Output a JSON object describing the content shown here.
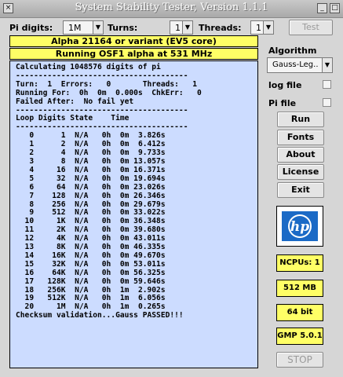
{
  "window": {
    "title": "System Stability Tester, Version 1.1.1"
  },
  "toolbar": {
    "pi_digits_label": "Pi digits:",
    "pi_digits_value": "1M",
    "turns_label": "Turns:",
    "turns_value": "1",
    "threads_label": "Threads:",
    "threads_value": "1",
    "test_label": "Test"
  },
  "banners": {
    "cpu": "Alpha 21164 or variant (EV5 core)",
    "os": "Running OSF1 alpha at 531 MHz"
  },
  "console": {
    "lines": [
      "Calculating 1048576 digits of pi",
      "--------------------------------------",
      "Turn:  1  Errors:   0       Threads:   1",
      "Running For:  0h  0m  0.000s  ChkErr:   0",
      "Failed After:  No fail yet",
      "--------------------------------------",
      "Loop Digits State    Time",
      "--------------------------------------",
      "   0      1  N/A   0h  0m  3.826s",
      "   1      2  N/A   0h  0m  6.412s",
      "   2      4  N/A   0h  0m  9.733s",
      "   3      8  N/A   0h  0m 13.057s",
      "   4     16  N/A   0h  0m 16.371s",
      "   5     32  N/A   0h  0m 19.694s",
      "   6     64  N/A   0h  0m 23.026s",
      "   7    128  N/A   0h  0m 26.346s",
      "   8    256  N/A   0h  0m 29.679s",
      "   9    512  N/A   0h  0m 33.022s",
      "  10     1K  N/A   0h  0m 36.348s",
      "  11     2K  N/A   0h  0m 39.680s",
      "  12     4K  N/A   0h  0m 43.011s",
      "  13     8K  N/A   0h  0m 46.335s",
      "  14    16K  N/A   0h  0m 49.670s",
      "  15    32K  N/A   0h  0m 53.011s",
      "  16    64K  N/A   0h  0m 56.325s",
      "  17   128K  N/A   0h  0m 59.646s",
      "  18   256K  N/A   0h  1m  2.902s",
      "  19   512K  N/A   0h  1m  6.056s",
      "  20     1M  N/A   0h  1m  0.265s",
      "Checksum validation...Gauss PASSED!!!"
    ]
  },
  "sidebar": {
    "algorithm_label": "Algorithm",
    "algorithm_value": "Gauss-Leg..",
    "log_file_label": "log file",
    "pi_file_label": "Pi file",
    "buttons": {
      "run": "Run",
      "fonts": "Fonts",
      "about": "About",
      "license": "License",
      "exit": "Exit"
    },
    "logo_text": "hp",
    "info": {
      "ncpus": "NCPUs: 1",
      "memory": "512 MB",
      "bits": "64 bit",
      "gmp": "GMP 5.0.1"
    },
    "stop_label": "STOP"
  },
  "colors": {
    "banner_bg": "#ffff66",
    "console_bg": "#ccdcff",
    "hp_blue": "#1b6ac6"
  }
}
